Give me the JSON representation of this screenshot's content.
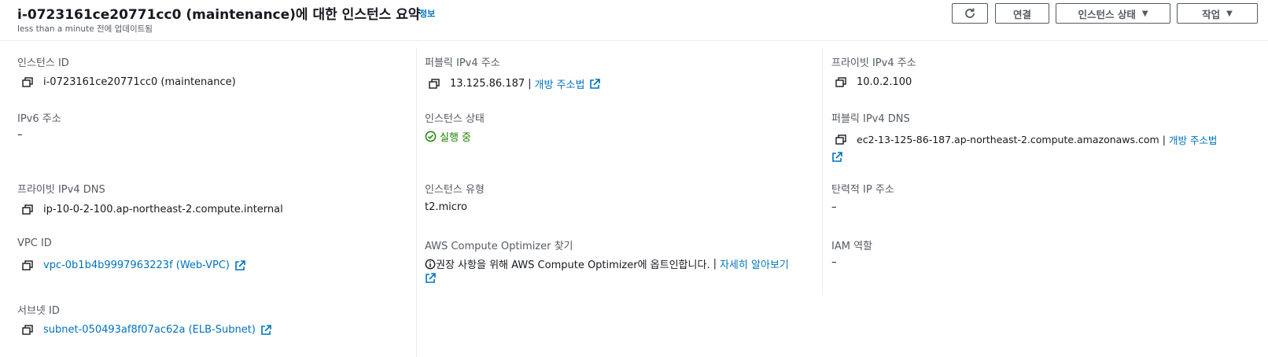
{
  "header": {
    "title": "i-0723161ce20771cc0 (maintenance)에 대한 인스턴스 요약",
    "info_link": "정보",
    "updated": "less than a minute 전에 업데이트됨",
    "buttons": {
      "connect": "연결",
      "instance_state": "인스턴스 상태",
      "actions": "작업"
    }
  },
  "fields": {
    "instance_id": {
      "label": "인스턴스 ID",
      "value": "i-0723161ce20771cc0 (maintenance)"
    },
    "public_ipv4": {
      "label": "퍼블릭 IPv4 주소",
      "value": "13.125.86.187",
      "link": "개방 주소법"
    },
    "private_ipv4": {
      "label": "프라이빗 IPv4 주소",
      "value": "10.0.2.100"
    },
    "ipv6": {
      "label": "IPv6 주소",
      "value": "–"
    },
    "instance_state": {
      "label": "인스턴스 상태",
      "value": "실행 중"
    },
    "public_dns": {
      "label": "퍼블릭 IPv4 DNS",
      "value": "ec2-13-125-86-187.ap-northeast-2.compute.amazonaws.com",
      "link": "개방 주소법"
    },
    "private_dns": {
      "label": "프라이빗 IPv4 DNS",
      "value": "ip-10-0-2-100.ap-northeast-2.compute.internal"
    },
    "instance_type": {
      "label": "인스턴스 유형",
      "value": "t2.micro"
    },
    "elastic_ip": {
      "label": "탄력적 IP 주소",
      "value": "–"
    },
    "vpc_id": {
      "label": "VPC ID",
      "value": "vpc-0b1b4b9997963223f (Web-VPC)"
    },
    "optimizer": {
      "label": "AWS Compute Optimizer 찾기",
      "value": "권장 사항을 위해 AWS Compute Optimizer에 옵트인합니다.",
      "link": "자세히 알아보기"
    },
    "iam_role": {
      "label": "IAM 역할",
      "value": "–"
    },
    "subnet_id": {
      "label": "서브넷 ID",
      "value": "subnet-050493af8f07ac62a (ELB-Subnet)"
    }
  },
  "colors": {
    "link": "#0073bb",
    "label": "#545b64",
    "success": "#1d8102",
    "text": "#16191f"
  }
}
